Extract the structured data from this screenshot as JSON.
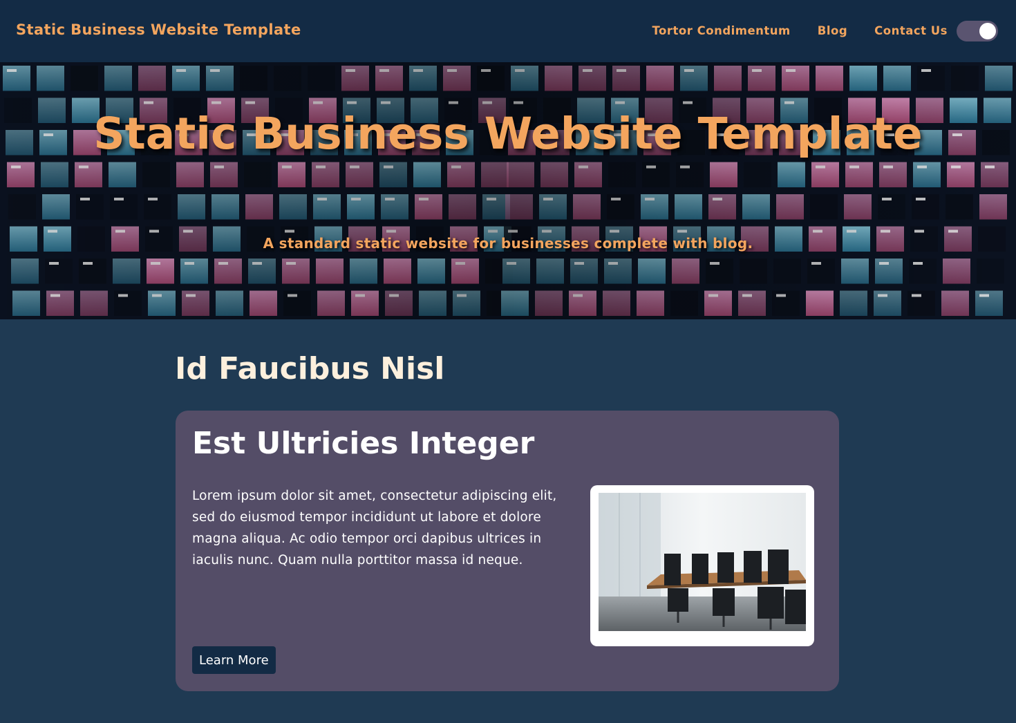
{
  "navbar": {
    "brand": "Static Business Website Template",
    "links": [
      "Tortor Condimentum",
      "Blog",
      "Contact Us"
    ],
    "theme_toggle": "dark-mode-toggle"
  },
  "hero": {
    "title": "Static Business Website Template",
    "subtitle": "A standard static website for businesses complete with blog.",
    "background_image": "night-office-building-windows"
  },
  "section": {
    "title": "Id Faucibus Nisl",
    "card": {
      "title": "Est Ultricies Integer",
      "text": "Lorem ipsum dolor sit amet, consectetur adipiscing elit, sed do eiusmod tempor incididunt ut labore et dolore magna aliqua. Ac odio tempor orci dapibus ultrices in iaculis nunc. Quam nulla porttitor massa id neque.",
      "button_label": "Learn More",
      "image": "conference-room-photo"
    }
  },
  "colors": {
    "navbar_bg": "#132b45",
    "page_bg": "#1f3a53",
    "accent": "#f3a55e",
    "card_bg": "#544d67",
    "heading_light": "#fdf0dd"
  }
}
